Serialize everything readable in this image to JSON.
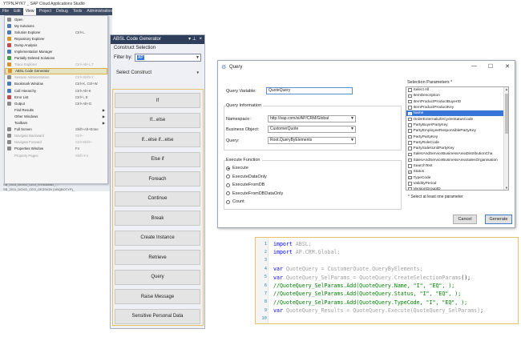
{
  "vs": {
    "title": "YTPNJ4YK7 _ SAP Cloud Applications Studio",
    "menus": [
      "File",
      "Edit",
      "View",
      "Project",
      "Debug",
      "Tools",
      "Administration"
    ],
    "tree": [
      "SB_2011_DOXO_CEO_SYS0609D_...",
      "SB_2011_DOXO_CEO_DEZSION (VBQBOTYP)_"
    ]
  },
  "view_menu": [
    {
      "label": "Open",
      "shortcut": "",
      "icon": "gray",
      "state": "normal"
    },
    {
      "label": "My Solutions",
      "shortcut": "",
      "icon": "blue",
      "state": "normal"
    },
    {
      "label": "Solution Explorer",
      "shortcut": "Ctrl+L",
      "icon": "blue",
      "state": "normal"
    },
    {
      "label": "Repository Explorer",
      "shortcut": "",
      "icon": "orange",
      "state": "normal"
    },
    {
      "label": "Dump Analysis",
      "shortcut": "",
      "icon": "red",
      "state": "normal"
    },
    {
      "label": "Implementation Manager",
      "shortcut": "",
      "icon": "blue",
      "state": "normal"
    },
    {
      "label": "Partially Deleted Solutions",
      "shortcut": "",
      "icon": "green",
      "state": "normal"
    },
    {
      "label": "Trace Explorer",
      "shortcut": "Ctrl+Alt+L,T",
      "icon": "orange",
      "state": "dim"
    },
    {
      "label": "ABSL Code Generator",
      "shortcut": "",
      "icon": "orange",
      "state": "highlighted"
    },
    {
      "label": "Session Administration",
      "shortcut": "Ctrl+Shift+Y",
      "icon": "gray",
      "state": "dim"
    },
    {
      "label": "Bookmark Window",
      "shortcut": "Ctrl+K, Ctrl+W",
      "icon": "blue",
      "state": "normal"
    },
    {
      "label": "Call Hierarchy",
      "shortcut": "Ctrl+Alt+K",
      "icon": "blue",
      "state": "normal"
    },
    {
      "label": "Error List",
      "shortcut": "Ctrl+\\, E",
      "icon": "red",
      "state": "normal"
    },
    {
      "label": "Output",
      "shortcut": "Ctrl+Alt+O",
      "icon": "gray",
      "state": "normal"
    },
    {
      "label": "Find Results",
      "shortcut": "",
      "icon": "none",
      "state": "submenu"
    },
    {
      "label": "Other Windows",
      "shortcut": "",
      "icon": "none",
      "state": "submenu"
    },
    {
      "label": "Toolbars",
      "shortcut": "",
      "icon": "none",
      "state": "submenu"
    },
    {
      "label": "Full Screen",
      "shortcut": "Shift+Alt+Enter",
      "icon": "gray",
      "state": "normal"
    },
    {
      "label": "Navigate Backward",
      "shortcut": "Ctrl+-",
      "icon": "gray",
      "state": "dim"
    },
    {
      "label": "Navigate Forward",
      "shortcut": "Ctrl+Shift+-",
      "icon": "gray",
      "state": "dim"
    },
    {
      "label": "Properties Window",
      "shortcut": "F4",
      "icon": "gray",
      "state": "normal"
    },
    {
      "label": "Property Pages",
      "shortcut": "Shift+F4",
      "icon": "none",
      "state": "dim"
    }
  ],
  "absl": {
    "title": "ABSL Code Generator",
    "pin_icon": "pin-icon",
    "section_title": "Construct Selection",
    "filter_label": "Filter by:",
    "filter_value": "AP",
    "select_label": "Select Construct",
    "constructs": [
      "If",
      "If...else",
      "If...else if...else",
      "Else if",
      "Foreach",
      "Continue",
      "Break",
      "Create Instance",
      "Retrieve",
      "Query",
      "Raise Message",
      "Sensitive Personal Data"
    ]
  },
  "query_dialog": {
    "title": "Query",
    "query_variable_label": "Query Variable:",
    "query_variable_value": "QuoteQuery",
    "info_title": "Query Information",
    "namespace_label": "Namespace:",
    "namespace_value": "http://sap.com/xi/AP/CRM/Global",
    "bo_label": "Business Object:",
    "bo_value": "CustomerQuote",
    "query_label": "Query:",
    "query_value": "Root.QueryByElements",
    "exec_title": "Execute Function",
    "exec_options": [
      {
        "label": "Execute",
        "checked": true
      },
      {
        "label": "ExecuteDataOnly",
        "checked": false
      },
      {
        "label": "ExecuteFromDB",
        "checked": false
      },
      {
        "label": "ExecuteFromDBDataOnly",
        "checked": false
      },
      {
        "label": "Count",
        "checked": false
      }
    ],
    "params_title": "Selection Parameters *",
    "params": [
      {
        "label": "Select All",
        "checked": false,
        "selected": false
      },
      {
        "label": "ItemDescription",
        "checked": false,
        "selected": false
      },
      {
        "label": "ItemProductProductBuyerID",
        "checked": false,
        "selected": false
      },
      {
        "label": "ItemProductProductKey",
        "checked": false,
        "selected": false
      },
      {
        "label": "Name",
        "checked": true,
        "selected": true
      },
      {
        "label": "OrderExternalLifeCycleStatusCode",
        "checked": false,
        "selected": false
      },
      {
        "label": "PartyBuyerPartyKey",
        "checked": false,
        "selected": false
      },
      {
        "label": "PartyEmployeeResponsiblePartyKey",
        "checked": false,
        "selected": false
      },
      {
        "label": "PartyPartyKey",
        "checked": false,
        "selected": false
      },
      {
        "label": "PartyRoleCode",
        "checked": false,
        "selected": false
      },
      {
        "label": "PartySalesUnitPartyKey",
        "checked": false,
        "selected": false
      },
      {
        "label": "SalesAndServiceBusinessAreaDistributionCha",
        "checked": false,
        "selected": false
      },
      {
        "label": "SalesAndServiceBusinessAreaSalesOrganisation",
        "checked": false,
        "selected": false
      },
      {
        "label": "SearchText",
        "checked": false,
        "selected": false
      },
      {
        "label": "Status",
        "checked": true,
        "selected": false
      },
      {
        "label": "TypeCode",
        "checked": true,
        "selected": false
      },
      {
        "label": "ValidityPeriod",
        "checked": false,
        "selected": false
      },
      {
        "label": "VersionGroupID",
        "checked": false,
        "selected": false
      }
    ],
    "params_note": "* Select at least one parameter",
    "cancel_label": "Cancel",
    "generate_label": "Generate"
  },
  "code": {
    "lines": [
      {
        "n": "1",
        "parts": [
          {
            "t": "import",
            "c": "kw"
          },
          {
            "t": " ABSL;",
            "c": "fd"
          }
        ]
      },
      {
        "n": "2",
        "parts": [
          {
            "t": "import",
            "c": "kw"
          },
          {
            "t": " AP.CRM.Global;",
            "c": "fd"
          }
        ]
      },
      {
        "n": "3",
        "parts": []
      },
      {
        "n": "4",
        "parts": [
          {
            "t": "var",
            "c": "kw"
          },
          {
            "t": " QuoteQuery = CustomerQuote.QueryByElements;",
            "c": "fd"
          }
        ]
      },
      {
        "n": "5",
        "parts": [
          {
            "t": "var",
            "c": "kw"
          },
          {
            "t": " QuoteQuery_SelParams = QuoteQuery.CreateSelectionParams",
            "c": "fd"
          },
          {
            "t": "();",
            "c": "pl"
          }
        ]
      },
      {
        "n": "6",
        "parts": [
          {
            "t": "//QuoteQuery_SelParams.Add(QuoteQuery.Name, \"I\", \"EQ\", );",
            "c": "cm"
          }
        ]
      },
      {
        "n": "7",
        "parts": [
          {
            "t": "//QuoteQuery_SelParams.Add(QuoteQuery.Status, \"I\", \"EQ\", );",
            "c": "cm"
          }
        ]
      },
      {
        "n": "8",
        "parts": [
          {
            "t": "//QuoteQuery_SelParams.Add(QuoteQuery.TypeCode, \"I\", \"EQ\", );",
            "c": "cm"
          }
        ]
      },
      {
        "n": "9",
        "parts": [
          {
            "t": "var",
            "c": "kw"
          },
          {
            "t": " QuoteQuery_Results = QuoteQuery.Execute(QuoteQuery_SelParams)",
            "c": "fd"
          },
          {
            "t": ";",
            "c": "pl"
          }
        ]
      },
      {
        "n": "10",
        "parts": []
      }
    ]
  },
  "colors": {
    "accent_highlight": "#e6c366",
    "vs_titlebar": "#2f3e5a",
    "selection": "#3875d7"
  }
}
